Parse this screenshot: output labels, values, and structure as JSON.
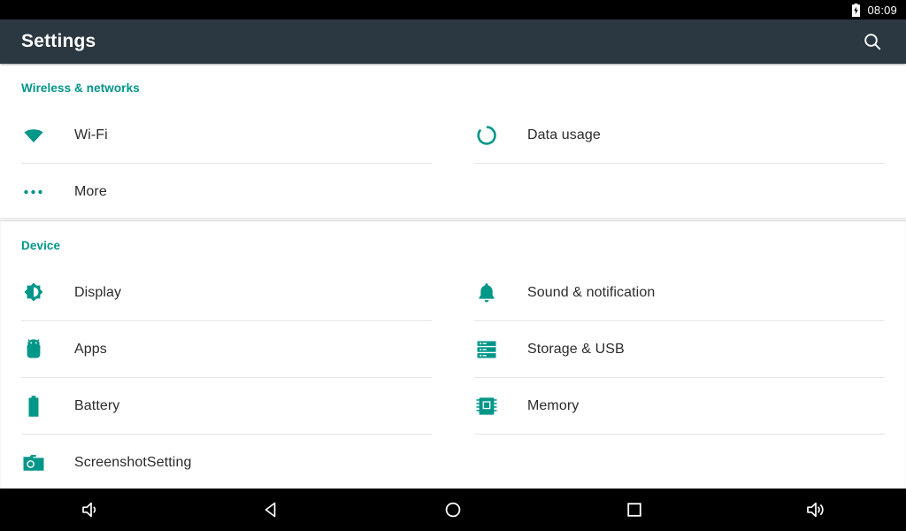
{
  "status_bar": {
    "clock": "08:09",
    "battery_icon": "battery-charging-icon"
  },
  "toolbar": {
    "title": "Settings",
    "search_icon": "search-icon"
  },
  "colors": {
    "accent_teal": "#009688",
    "toolbar_bg": "#2b3841",
    "status_bg": "#000000",
    "page_bg": "#ffffff",
    "label_text": "#2b2b2b",
    "divider": "#e4e4e4"
  },
  "sections": [
    {
      "header": "Wireless & networks",
      "items": [
        {
          "label": "Wi-Fi",
          "icon": "wifi-icon"
        },
        {
          "label": "Data usage",
          "icon": "data-usage-icon"
        },
        {
          "label": "More",
          "icon": "more-dots-icon"
        }
      ]
    },
    {
      "header": "Device",
      "items": [
        {
          "label": "Display",
          "icon": "brightness-icon"
        },
        {
          "label": "Sound & notification",
          "icon": "bell-icon"
        },
        {
          "label": "Apps",
          "icon": "android-robot-icon"
        },
        {
          "label": "Storage & USB",
          "icon": "storage-icon"
        },
        {
          "label": "Battery",
          "icon": "battery-icon"
        },
        {
          "label": "Memory",
          "icon": "memory-chip-icon"
        },
        {
          "label": "ScreenshotSetting",
          "icon": "camera-icon"
        }
      ]
    }
  ],
  "navigation_bar": {
    "buttons": [
      {
        "name": "volume-down-button",
        "icon": "volume-down-icon"
      },
      {
        "name": "back-button",
        "icon": "back-triangle-icon"
      },
      {
        "name": "home-button",
        "icon": "home-circle-icon"
      },
      {
        "name": "recents-button",
        "icon": "recents-square-icon"
      },
      {
        "name": "volume-up-button",
        "icon": "volume-up-icon"
      }
    ]
  }
}
